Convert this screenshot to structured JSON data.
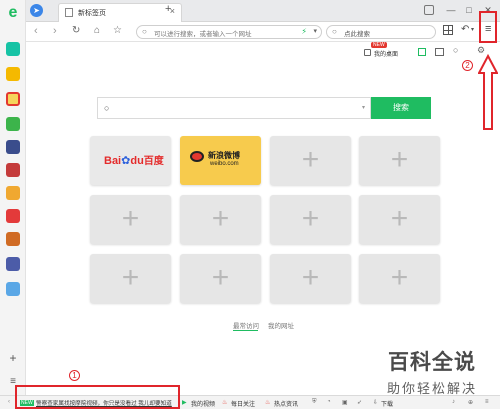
{
  "tab": {
    "title": "新标签页",
    "close": "×",
    "new_tab": "+"
  },
  "window": {
    "min": "—",
    "max": "□",
    "close": "✕"
  },
  "toolbar": {
    "address_placeholder": "可以进行搜索，或者输入一个网址",
    "search_placeholder": "点此搜索",
    "menu": "≡"
  },
  "quickbar": {
    "badge": "NEW",
    "desktop_label": "我的桌面"
  },
  "search": {
    "button_label": "搜索"
  },
  "tiles": {
    "baidu": {
      "logo_a": "Bai",
      "logo_b": "du",
      "logo_c": "百度"
    },
    "weibo": {
      "name": "新浪微博",
      "domain": "weibo.com"
    }
  },
  "tile_plus": "+",
  "bottom_links": {
    "recent": "最常访问",
    "mine": "我的网址"
  },
  "status": {
    "news_badge": "NEW",
    "news_text": "警察查家属找按摩院视频，你只是没看过 我儿却要知道",
    "items": [
      "我的视频",
      "每日关注",
      "热点资讯",
      "下载"
    ]
  },
  "annotations": {
    "one": "1",
    "two": "2"
  },
  "watermark": {
    "main": "百科全说",
    "sub": "助你轻松解决"
  },
  "colors": {
    "accent_green": "#1fbc61",
    "annotation_red": "#e0252b",
    "weibo_yellow": "#f7cb4d"
  }
}
